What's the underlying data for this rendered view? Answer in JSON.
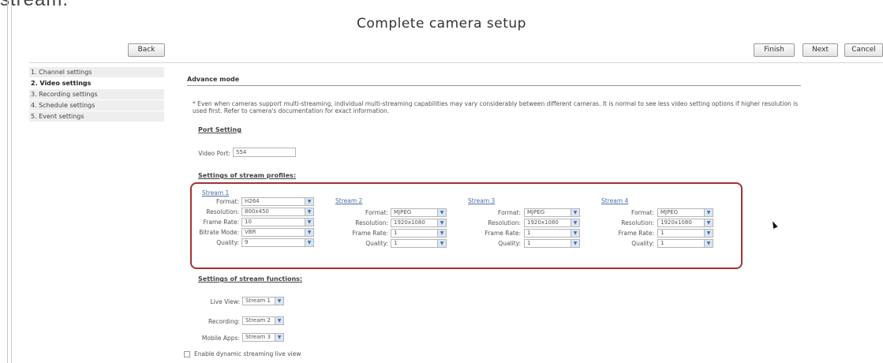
{
  "caption": "stream.",
  "title": "Complete camera setup",
  "buttons": {
    "back": "Back",
    "finish": "Finish",
    "next": "Next",
    "cancel": "Cancel"
  },
  "steps": [
    {
      "label": "1. Channel settings",
      "active": false
    },
    {
      "label": "2. Video settings",
      "active": true
    },
    {
      "label": "3. Recording settings",
      "active": false
    },
    {
      "label": "4. Schedule settings",
      "active": false
    },
    {
      "label": "5. Event settings",
      "active": false
    }
  ],
  "advance_mode": "Advance mode",
  "note": "* Even when cameras support multi-streaming, individual multi-streaming capabilities may vary considerably between different cameras. It is normal to see less video setting options if higher resolution is used first. Refer to camera's documentation for exact information.",
  "port_setting": {
    "heading": "Port Setting",
    "video_port_label": "Video Port:",
    "video_port_value": "554"
  },
  "stream_profiles": {
    "heading": "Settings of stream profiles:",
    "labels": {
      "format": "Format:",
      "resolution": "Resolution:",
      "frame_rate": "Frame Rate:",
      "bitrate_mode": "Bitrate Mode:",
      "quality": "Quality:"
    },
    "streams": [
      {
        "title": "Stream 1",
        "format": "H264",
        "resolution": "800x450",
        "frame_rate": "10",
        "bitrate_mode": "VBR",
        "quality": "9"
      },
      {
        "title": "Stream 2",
        "format": "MJPEG",
        "resolution": "1920x1080",
        "frame_rate": "1",
        "quality": "1"
      },
      {
        "title": "Stream 3",
        "format": "MJPEG",
        "resolution": "1920x1080",
        "frame_rate": "1",
        "quality": "1"
      },
      {
        "title": "Stream 4",
        "format": "MJPEG",
        "resolution": "1920x1080",
        "frame_rate": "1",
        "quality": "1"
      }
    ]
  },
  "stream_functions": {
    "heading": "Settings of stream functions:",
    "live_view_label": "Live View:",
    "live_view_value": "Stream 1",
    "recording_label": "Recording:",
    "recording_value": "Stream 2",
    "mobile_label": "Mobile Apps:",
    "mobile_value": "Stream 3"
  },
  "dynamic_streaming": {
    "label": "Enable dynamic streaming live view",
    "checked": false
  },
  "icons": {
    "dropdown": "chevron-down-icon",
    "pointer": "mouse-pointer-icon"
  },
  "colors": {
    "highlight_border": "#a33232",
    "link": "#4a6fa5"
  }
}
